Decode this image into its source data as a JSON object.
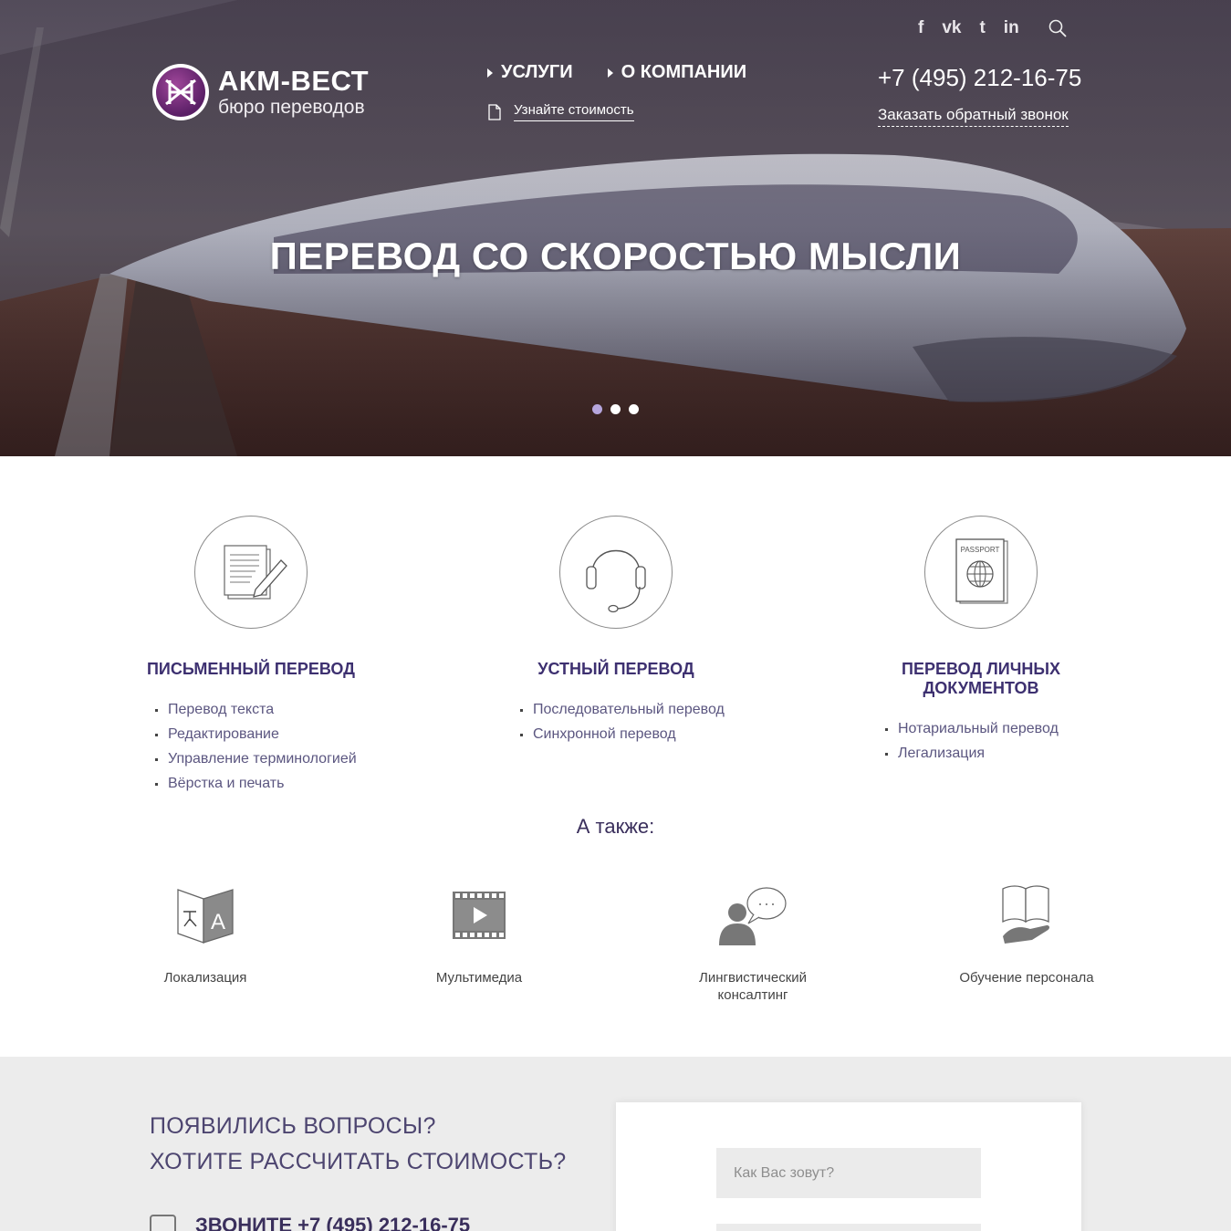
{
  "brand": {
    "title": "АКМ-ВЕСТ",
    "subtitle": "бюро переводов"
  },
  "nav": {
    "services": "УСЛУГИ",
    "about": "О КОМПАНИИ",
    "price_link": "Узнайте стоимость"
  },
  "socials": {
    "facebook": "f",
    "vk": "vk",
    "twitter": "t",
    "linkedin": "in"
  },
  "header": {
    "phone": "+7 (495) 212-16-75",
    "callback": "Заказать обратный звонок"
  },
  "hero": {
    "title": "ПЕРЕВОД СО СКОРОСТЬЮ МЫСЛИ",
    "slides": 3,
    "active_slide": 1
  },
  "services": [
    {
      "title": "ПИСЬМЕННЫЙ ПЕРЕВОД",
      "icon": "document-pen-icon",
      "items": [
        "Перевод текста",
        "Редактирование",
        "Управление терминологией",
        "Вёрстка и печать"
      ]
    },
    {
      "title": "УСТНЫЙ ПЕРЕВОД",
      "icon": "headset-icon",
      "items": [
        "Последовательный перевод",
        "Синхронной перевод"
      ]
    },
    {
      "title_line1": "ПЕРЕВОД ЛИЧНЫХ",
      "title_line2": "ДОКУМЕНТОВ",
      "icon": "passport-icon",
      "icon_text": "PASSPORT",
      "items": [
        "Нотариальный перевод",
        "Легализация"
      ]
    }
  ],
  "also": {
    "heading": "А также:",
    "items": [
      {
        "label": "Локализация",
        "icon": "localization-icon"
      },
      {
        "label": "Мультимедиа",
        "icon": "video-icon"
      },
      {
        "label_line1": "Лингвистический",
        "label_line2": "консалтинг",
        "icon": "consulting-icon"
      },
      {
        "label": "Обучение персонала",
        "icon": "book-hand-icon"
      }
    ]
  },
  "contact": {
    "question_line1": "ПОЯВИЛИСЬ ВОПРОСЫ?",
    "question_line2": "ХОТИТЕ РАССЧИТАТЬ СТОИМОСТЬ?",
    "call_text": "ЗВОНИТЕ +7 (495) 212-16-75",
    "name_placeholder": "Как Вас зовут?"
  },
  "colors": {
    "accent": "#3d3070",
    "dot_active": "#b6a6dd",
    "section_bg": "#ececec"
  }
}
